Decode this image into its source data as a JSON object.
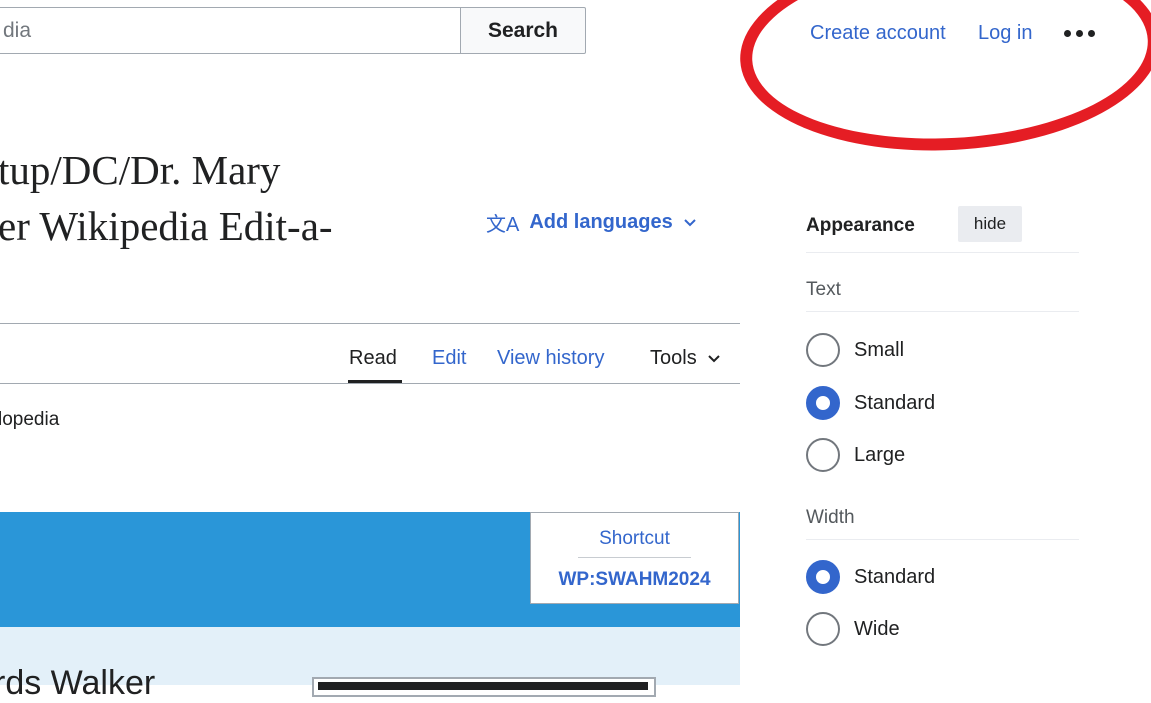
{
  "header": {
    "search_placeholder": "dia",
    "search_button": "Search",
    "create_account": "Create account",
    "log_in": "Log in",
    "more_icon": "ellipsis-icon"
  },
  "title": {
    "line1": "tup/DC/Dr. Mary",
    "line2": "er Wikipedia Edit-a-"
  },
  "languages": {
    "icon": "translate-icon",
    "label": "Add languages",
    "chevron": "chevron-down-icon"
  },
  "tabs": {
    "read": "Read",
    "edit": "Edit",
    "history": "View history",
    "tools": "Tools"
  },
  "tagline": "lopedia",
  "banner": {
    "shortcut_label": "Shortcut",
    "shortcut_code": "WP:SWAHM2024",
    "snippet": "rds Walker"
  },
  "appearance": {
    "title": "Appearance",
    "hide": "hide",
    "text_label": "Text",
    "text_options": [
      {
        "label": "Small",
        "checked": false
      },
      {
        "label": "Standard",
        "checked": true
      },
      {
        "label": "Large",
        "checked": false
      }
    ],
    "width_label": "Width",
    "width_options": [
      {
        "label": "Standard",
        "checked": true
      },
      {
        "label": "Wide",
        "checked": false
      }
    ]
  },
  "colors": {
    "link": "#3366cc",
    "annotation_circle": "#e51d24",
    "banner": "#2a96d8"
  }
}
